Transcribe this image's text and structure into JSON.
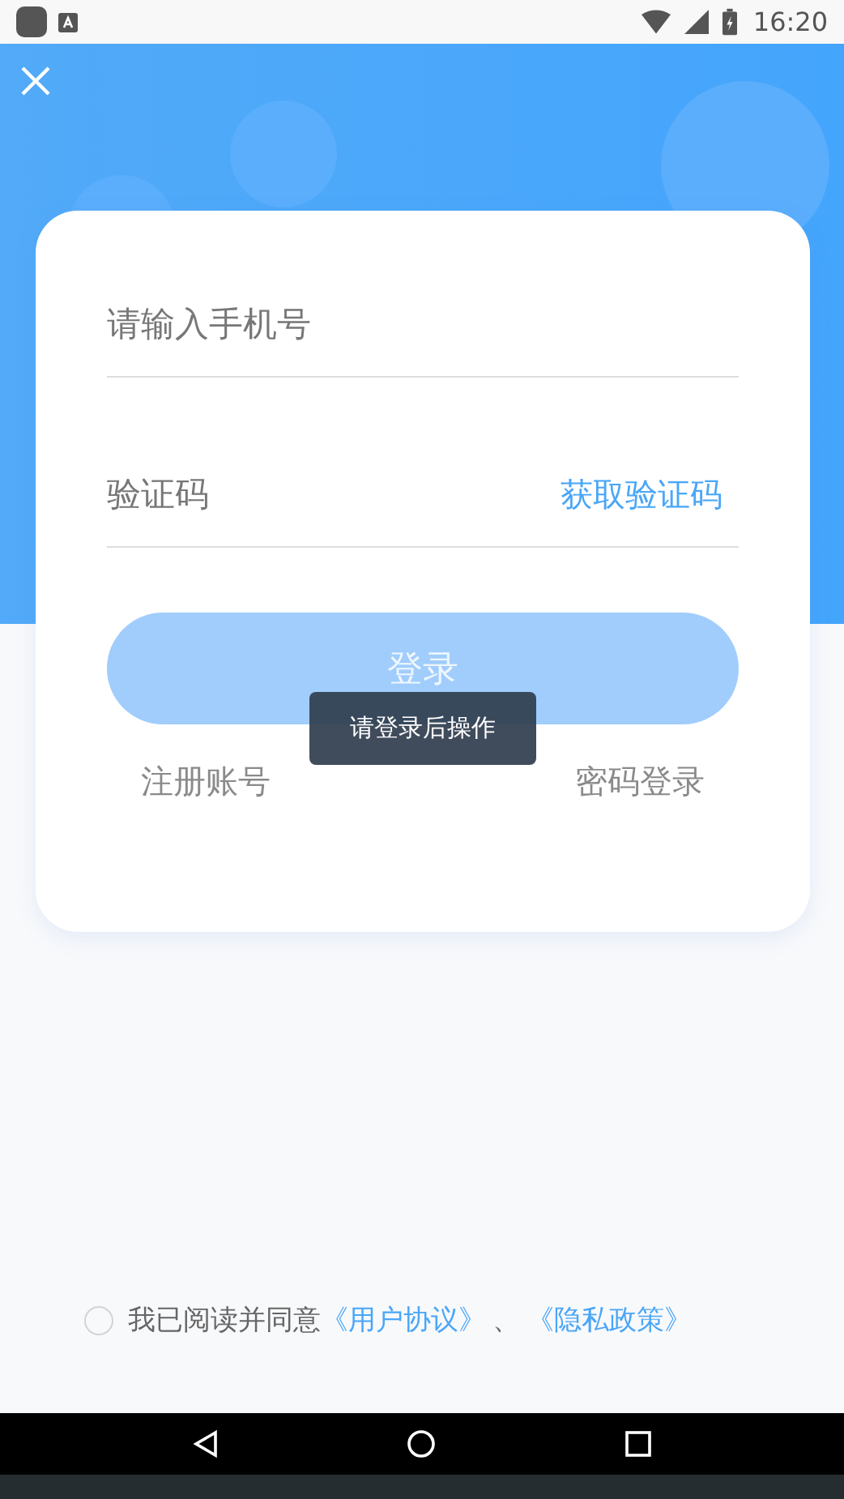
{
  "status_bar": {
    "time": "16:20"
  },
  "login_card": {
    "phone_field": {
      "placeholder": "请输入手机号"
    },
    "code_field": {
      "placeholder": "验证码",
      "action": "获取验证码"
    },
    "login_button": {
      "label": "登录",
      "disabled": true
    },
    "links": [
      "注册账号",
      "密码登录"
    ]
  },
  "toast": "请登录后操作",
  "agreement": {
    "checked": false,
    "text": "我已阅读并同意",
    "links": [
      "《用户协议》",
      "《隐私政策》"
    ],
    "separator": "、"
  }
}
